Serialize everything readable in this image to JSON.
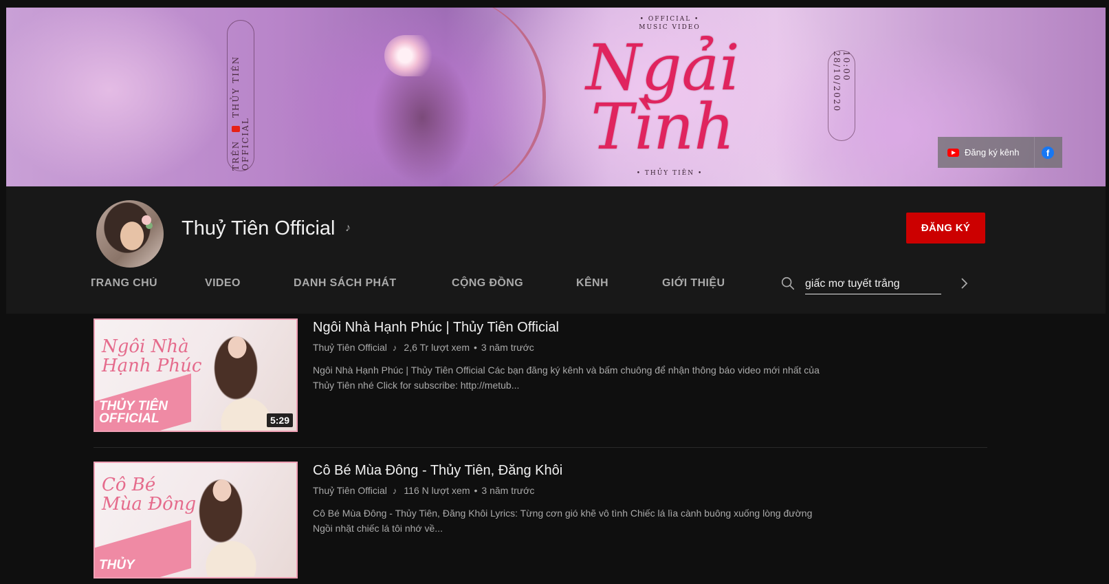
{
  "banner": {
    "official_music_video": "• OFFICIAL •\nMUSIC VIDEO",
    "title_line1": "Ngải",
    "title_line2": "Tình",
    "artist": "• THỦY TIÊN •",
    "left_pill_line1": "TRÊN",
    "left_pill_line2": "THỦY TIÊN OFFICIAL",
    "right_pill_line1": "10:00",
    "right_pill_line2": "28/10/2020",
    "subscribe_link_label": "Đăng ký kênh"
  },
  "channel": {
    "name": "Thuỷ Tiên Official",
    "subscribe_label": "ĐĂNG KÝ"
  },
  "tabs": [
    {
      "label": "TRANG CHỦ"
    },
    {
      "label": "VIDEO"
    },
    {
      "label": "DANH SÁCH PHÁT"
    },
    {
      "label": "CỘNG ĐỒNG"
    },
    {
      "label": "KÊNH"
    },
    {
      "label": "GIỚI THIỆU"
    }
  ],
  "search": {
    "value": "giấc mơ tuyết trắng"
  },
  "videos": [
    {
      "title": "Ngôi Nhà Hạnh Phúc | Thủy Tiên Official",
      "channel": "Thuỷ Tiên Official",
      "views": "2,6 Tr lượt xem",
      "age": "3 năm trước",
      "description": "Ngôi Nhà Hạnh Phúc | Thủy Tiên Official Các bạn đăng ký kênh và bấm chuông để nhận thông báo video mới nhất của Thủy Tiên nhé Click for subscribe: http://metub...",
      "duration": "5:29",
      "thumb_title": "Ngôi Nhà\nHạnh Phúc",
      "thumb_brand": "THỦY TIÊN\nOFFICIAL"
    },
    {
      "title": "Cô Bé Mùa Đông - Thủy Tiên, Đăng Khôi",
      "channel": "Thuỷ Tiên Official",
      "views": "116 N lượt xem",
      "age": "3 năm trước",
      "description": "Cô Bé Mùa Đông - Thủy Tiên, Đăng Khôi Lyrics: Từng cơn gió khẽ vô tình Chiếc lá lìa cành buông xuống lòng đường Ngồi nhặt chiếc lá tôi nhớ về...",
      "thumb_title": "Cô Bé\nMùa Đông",
      "thumb_brand": "THỦY"
    }
  ],
  "colors": {
    "background": "#0f0f0f",
    "header": "#181818",
    "subscribe": "#cc0000",
    "title_art": "#e0245e",
    "thumb_border": "#f0a0b5"
  },
  "icons": [
    "music-note-icon",
    "search-icon",
    "chevron-right-icon",
    "youtube-icon",
    "facebook-icon"
  ]
}
